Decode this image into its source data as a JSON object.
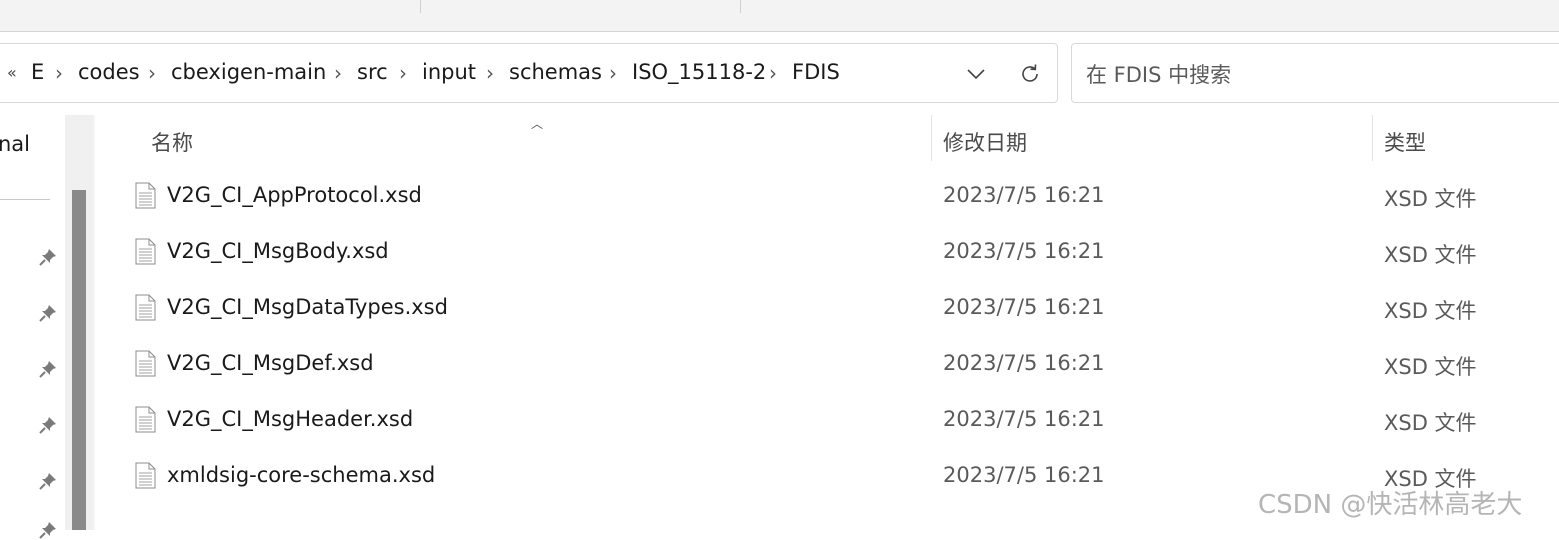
{
  "breadcrumb": {
    "overflow": "«",
    "items": [
      "E",
      "codes",
      "cbexigen-main",
      "src",
      "input",
      "schemas",
      "ISO_15118-2",
      "FDIS"
    ],
    "separator": "›"
  },
  "address_buttons": {
    "history_dropdown_icon": "chevron-down-icon",
    "refresh_icon": "refresh-icon"
  },
  "search": {
    "placeholder": "在 FDIS 中搜索"
  },
  "nav": {
    "partial_label": "nal",
    "pinned_count": 6
  },
  "columns": {
    "name": "名称",
    "date": "修改日期",
    "type": "类型"
  },
  "files": [
    {
      "name": "V2G_CI_AppProtocol.xsd",
      "date": "2023/7/5 16:21",
      "type": "XSD 文件"
    },
    {
      "name": "V2G_CI_MsgBody.xsd",
      "date": "2023/7/5 16:21",
      "type": "XSD 文件"
    },
    {
      "name": "V2G_CI_MsgDataTypes.xsd",
      "date": "2023/7/5 16:21",
      "type": "XSD 文件"
    },
    {
      "name": "V2G_CI_MsgDef.xsd",
      "date": "2023/7/5 16:21",
      "type": "XSD 文件"
    },
    {
      "name": "V2G_CI_MsgHeader.xsd",
      "date": "2023/7/5 16:21",
      "type": "XSD 文件"
    },
    {
      "name": "xmldsig-core-schema.xsd",
      "date": "2023/7/5 16:21",
      "type": "XSD 文件"
    }
  ],
  "watermark": "CSDN @快活林高老大"
}
